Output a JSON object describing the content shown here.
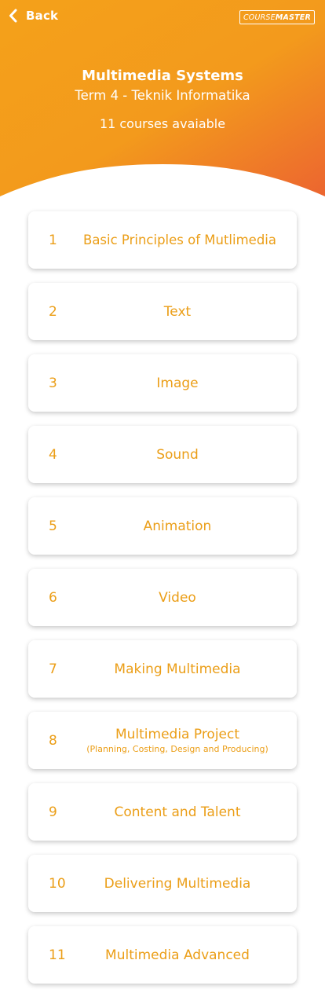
{
  "header": {
    "back_label": "Back",
    "logo": {
      "part1": "COURSE",
      "part2": "MASTER"
    },
    "title": "Multimedia Systems",
    "subtitle": "Term 4 - Teknik Informatika",
    "course_count": "11 courses avaiable",
    "gradient_start": "#f4a11a",
    "gradient_end": "#ec6530"
  },
  "accent_color": "#eb9e17",
  "courses": [
    {
      "number": "1",
      "title": "Basic Principles of Mutlimedia",
      "subtitle": ""
    },
    {
      "number": "2",
      "title": "Text",
      "subtitle": ""
    },
    {
      "number": "3",
      "title": "Image",
      "subtitle": ""
    },
    {
      "number": "4",
      "title": "Sound",
      "subtitle": ""
    },
    {
      "number": "5",
      "title": "Animation",
      "subtitle": ""
    },
    {
      "number": "6",
      "title": "Video",
      "subtitle": ""
    },
    {
      "number": "7",
      "title": "Making Multimedia",
      "subtitle": ""
    },
    {
      "number": "8",
      "title": "Multimedia Project",
      "subtitle": "(Planning, Costing, Design and Producing)"
    },
    {
      "number": "9",
      "title": "Content and Talent",
      "subtitle": ""
    },
    {
      "number": "10",
      "title": "Delivering Multimedia",
      "subtitle": ""
    },
    {
      "number": "11",
      "title": "Multimedia Advanced",
      "subtitle": ""
    }
  ]
}
